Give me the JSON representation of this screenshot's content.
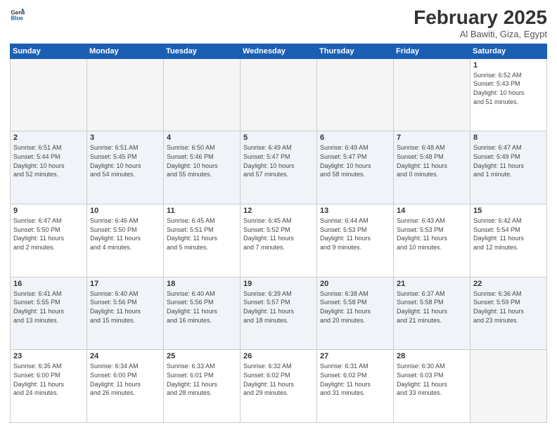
{
  "header": {
    "logo_line1": "General",
    "logo_line2": "Blue",
    "month": "February 2025",
    "location": "Al Bawiti, Giza, Egypt"
  },
  "days_of_week": [
    "Sunday",
    "Monday",
    "Tuesday",
    "Wednesday",
    "Thursday",
    "Friday",
    "Saturday"
  ],
  "weeks": [
    [
      {
        "num": "",
        "info": ""
      },
      {
        "num": "",
        "info": ""
      },
      {
        "num": "",
        "info": ""
      },
      {
        "num": "",
        "info": ""
      },
      {
        "num": "",
        "info": ""
      },
      {
        "num": "",
        "info": ""
      },
      {
        "num": "1",
        "info": "Sunrise: 6:52 AM\nSunset: 5:43 PM\nDaylight: 10 hours\nand 51 minutes."
      }
    ],
    [
      {
        "num": "2",
        "info": "Sunrise: 6:51 AM\nSunset: 5:44 PM\nDaylight: 10 hours\nand 52 minutes."
      },
      {
        "num": "3",
        "info": "Sunrise: 6:51 AM\nSunset: 5:45 PM\nDaylight: 10 hours\nand 54 minutes."
      },
      {
        "num": "4",
        "info": "Sunrise: 6:50 AM\nSunset: 5:46 PM\nDaylight: 10 hours\nand 55 minutes."
      },
      {
        "num": "5",
        "info": "Sunrise: 6:49 AM\nSunset: 5:47 PM\nDaylight: 10 hours\nand 57 minutes."
      },
      {
        "num": "6",
        "info": "Sunrise: 6:49 AM\nSunset: 5:47 PM\nDaylight: 10 hours\nand 58 minutes."
      },
      {
        "num": "7",
        "info": "Sunrise: 6:48 AM\nSunset: 5:48 PM\nDaylight: 11 hours\nand 0 minutes."
      },
      {
        "num": "8",
        "info": "Sunrise: 6:47 AM\nSunset: 5:49 PM\nDaylight: 11 hours\nand 1 minute."
      }
    ],
    [
      {
        "num": "9",
        "info": "Sunrise: 6:47 AM\nSunset: 5:50 PM\nDaylight: 11 hours\nand 2 minutes."
      },
      {
        "num": "10",
        "info": "Sunrise: 6:46 AM\nSunset: 5:50 PM\nDaylight: 11 hours\nand 4 minutes."
      },
      {
        "num": "11",
        "info": "Sunrise: 6:45 AM\nSunset: 5:51 PM\nDaylight: 11 hours\nand 5 minutes."
      },
      {
        "num": "12",
        "info": "Sunrise: 6:45 AM\nSunset: 5:52 PM\nDaylight: 11 hours\nand 7 minutes."
      },
      {
        "num": "13",
        "info": "Sunrise: 6:44 AM\nSunset: 5:53 PM\nDaylight: 11 hours\nand 9 minutes."
      },
      {
        "num": "14",
        "info": "Sunrise: 6:43 AM\nSunset: 5:53 PM\nDaylight: 11 hours\nand 10 minutes."
      },
      {
        "num": "15",
        "info": "Sunrise: 6:42 AM\nSunset: 5:54 PM\nDaylight: 11 hours\nand 12 minutes."
      }
    ],
    [
      {
        "num": "16",
        "info": "Sunrise: 6:41 AM\nSunset: 5:55 PM\nDaylight: 11 hours\nand 13 minutes."
      },
      {
        "num": "17",
        "info": "Sunrise: 6:40 AM\nSunset: 5:56 PM\nDaylight: 11 hours\nand 15 minutes."
      },
      {
        "num": "18",
        "info": "Sunrise: 6:40 AM\nSunset: 5:56 PM\nDaylight: 11 hours\nand 16 minutes."
      },
      {
        "num": "19",
        "info": "Sunrise: 6:39 AM\nSunset: 5:57 PM\nDaylight: 11 hours\nand 18 minutes."
      },
      {
        "num": "20",
        "info": "Sunrise: 6:38 AM\nSunset: 5:58 PM\nDaylight: 11 hours\nand 20 minutes."
      },
      {
        "num": "21",
        "info": "Sunrise: 6:37 AM\nSunset: 5:58 PM\nDaylight: 11 hours\nand 21 minutes."
      },
      {
        "num": "22",
        "info": "Sunrise: 6:36 AM\nSunset: 5:59 PM\nDaylight: 11 hours\nand 23 minutes."
      }
    ],
    [
      {
        "num": "23",
        "info": "Sunrise: 6:35 AM\nSunset: 6:00 PM\nDaylight: 11 hours\nand 24 minutes."
      },
      {
        "num": "24",
        "info": "Sunrise: 6:34 AM\nSunset: 6:00 PM\nDaylight: 11 hours\nand 26 minutes."
      },
      {
        "num": "25",
        "info": "Sunrise: 6:33 AM\nSunset: 6:01 PM\nDaylight: 11 hours\nand 28 minutes."
      },
      {
        "num": "26",
        "info": "Sunrise: 6:32 AM\nSunset: 6:02 PM\nDaylight: 11 hours\nand 29 minutes."
      },
      {
        "num": "27",
        "info": "Sunrise: 6:31 AM\nSunset: 6:02 PM\nDaylight: 11 hours\nand 31 minutes."
      },
      {
        "num": "28",
        "info": "Sunrise: 6:30 AM\nSunset: 6:03 PM\nDaylight: 11 hours\nand 33 minutes."
      },
      {
        "num": "",
        "info": ""
      }
    ]
  ]
}
